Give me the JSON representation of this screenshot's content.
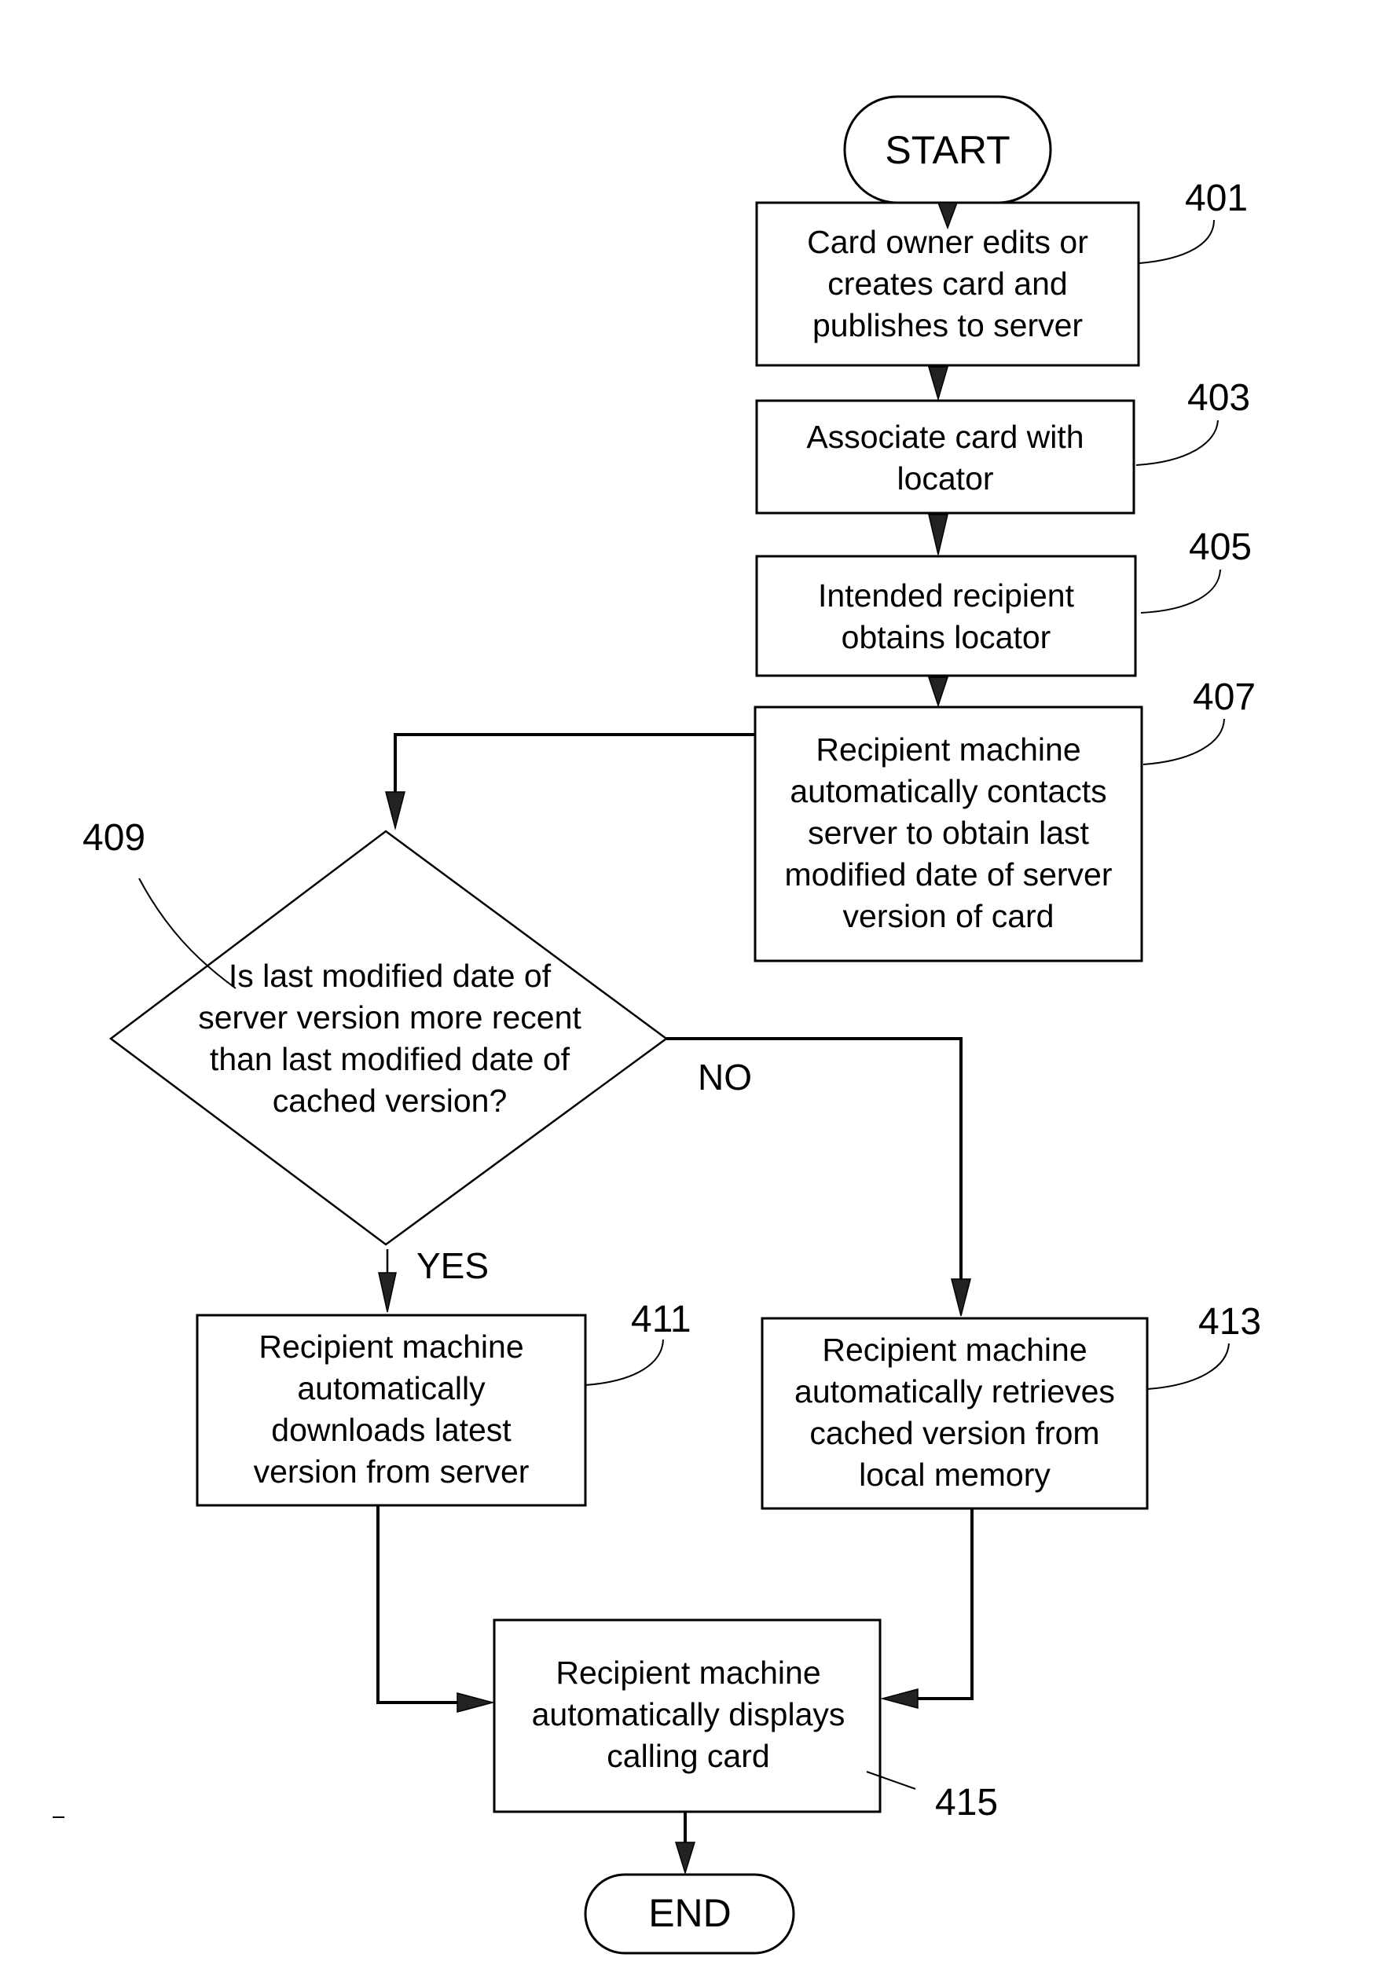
{
  "diagram": {
    "type": "flowchart",
    "start": "START",
    "end": "END",
    "steps": [
      {
        "id": "401",
        "lines": [
          "Card owner edits or",
          "creates card  and",
          "publishes to server"
        ]
      },
      {
        "id": "403",
        "lines": [
          "Associate card  with",
          "locator"
        ]
      },
      {
        "id": "405",
        "lines": [
          "Intended recipient",
          "obtains locator"
        ]
      },
      {
        "id": "407",
        "lines": [
          "Recipient machine",
          "automatically contacts",
          "server to obtain last",
          "modified date of server",
          "version of card"
        ]
      },
      {
        "id": "409",
        "lines": [
          "Is last modified date of",
          "server version more recent",
          "than last modified date of",
          "cached version?"
        ]
      },
      {
        "id": "411",
        "lines": [
          "Recipient machine",
          "automatically",
          "downloads latest",
          "version from server"
        ]
      },
      {
        "id": "413",
        "lines": [
          "Recipient machine",
          "automatically retrieves",
          "cached version from",
          "local memory"
        ]
      },
      {
        "id": "415",
        "lines": [
          "Recipient machine",
          "automatically displays",
          "calling card"
        ]
      }
    ],
    "branches": {
      "yes": "YES",
      "no": "NO"
    },
    "refs": {
      "r401": "401",
      "r403": "403",
      "r405": "405",
      "r407": "407",
      "r409": "409",
      "r411": "411",
      "r413": "413",
      "r415": "415"
    }
  }
}
